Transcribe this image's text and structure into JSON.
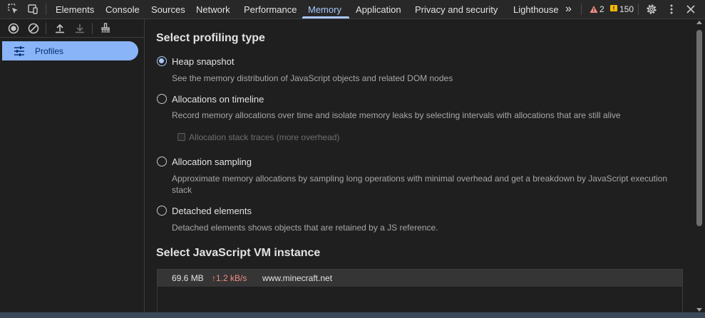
{
  "tabs": [
    {
      "label": "Elements"
    },
    {
      "label": "Console"
    },
    {
      "label": "Sources"
    },
    {
      "label": "Network"
    },
    {
      "label": "Performance"
    },
    {
      "label": "Memory"
    },
    {
      "label": "Application"
    },
    {
      "label": "Privacy and security"
    },
    {
      "label": "Lighthouse"
    }
  ],
  "active_tab": "Memory",
  "more_tabs_label": "»",
  "warnings_count": "2",
  "issues_count": "150",
  "sidebar": {
    "profiles_label": "Profiles"
  },
  "main": {
    "select_profiling_type": "Select profiling type",
    "options": [
      {
        "label": "Heap snapshot",
        "desc": "See the memory distribution of JavaScript objects and related DOM nodes",
        "checked": true
      },
      {
        "label": "Allocations on timeline",
        "desc": "Record memory allocations over time and isolate memory leaks by selecting intervals with allocations that are still alive",
        "checked": false
      },
      {
        "label": "Allocation sampling",
        "desc": "Approximate memory allocations by sampling long operations with minimal overhead and get a breakdown by JavaScript execution stack",
        "checked": false
      },
      {
        "label": "Detached elements",
        "desc": "Detached elements shows objects that are retained by a JS reference.",
        "checked": false
      }
    ],
    "stack_traces_label": "Allocation stack traces (more overhead)",
    "select_vm": "Select JavaScript VM instance",
    "vm_instances": [
      {
        "size": "69.6 MB",
        "rate": "↑1.2 kB/s",
        "url": "www.minecraft.net"
      }
    ]
  },
  "colors": {
    "accent": "#a8c7fa",
    "warning": "#f9ab00",
    "issue": "#fbbc04",
    "rate": "#f28b82"
  }
}
